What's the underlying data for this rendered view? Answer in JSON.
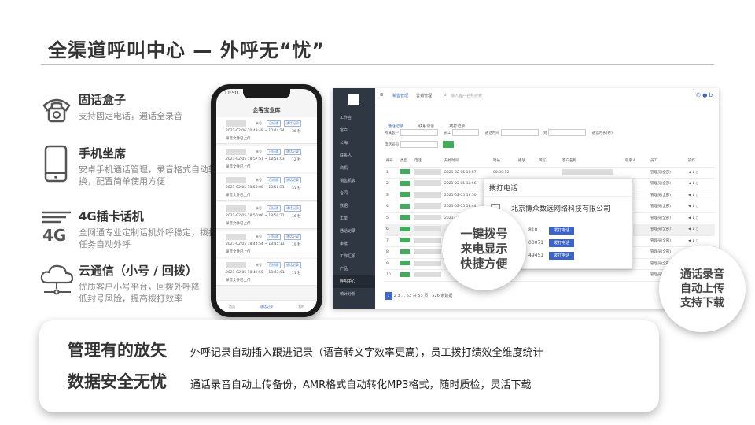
{
  "slide": {
    "title": "全渠道呼叫中心 — 外呼无“忧”"
  },
  "features": [
    {
      "icon": "telephone-icon",
      "title": "固话盒子",
      "desc": "支持固定电话，通话全录音"
    },
    {
      "icon": "smartphone-icon",
      "title": "手机坐席",
      "desc": "安卓手机通话管理，录音格式自动转换，配置简单使用方便"
    },
    {
      "icon": "4g-signal-icon",
      "title": "4G插卡话机",
      "desc": "全网通专业定制话机外呼稳定，拨打任务自动外呼"
    },
    {
      "icon": "cloud-network-icon",
      "title": "云通信（小号 / 回拨）",
      "desc": "优质客户小号平台，回拨外呼降低封号风险，提高拨打效率"
    }
  ],
  "phone": {
    "status_time": "11:50",
    "title": "企客宝业库",
    "items": [
      {
        "tag_a": "未号",
        "tag_b": "已接通",
        "tag_c": "通话记录",
        "time": "2021-02-06 10:43:48 ~ 10:44:24",
        "dur": "36 秒",
        "note": "录音文件已上传"
      },
      {
        "tag_a": "未号",
        "tag_b": "已接通",
        "tag_c": "通话记录",
        "time": "2021-02-05 18:57:51 ~ 18:58:03",
        "dur": "12 秒",
        "note": "录音文件已上传"
      },
      {
        "tag_a": "未号",
        "tag_b": "已接通",
        "tag_c": "通话记录",
        "time": "2021-02-05 18:50:00 ~ 18:50:31",
        "dur": "31 秒",
        "note": "录音文件已上传"
      },
      {
        "tag_a": "未号",
        "tag_b": "已接通",
        "tag_c": "通话记录",
        "time": "2021-02-05 18:50:06 ~ 18:50:22",
        "dur": "16 秒",
        "note": "录音文件已上传"
      },
      {
        "tag_a": "未号",
        "tag_b": "已接通",
        "tag_c": "通话记录",
        "time": "2021-02-05 18:44:54 ~ 18:45:13",
        "dur": "19 秒",
        "note": "录音文件已上传"
      },
      {
        "tag_a": "未号",
        "tag_b": "已接通",
        "tag_c": "通话记录",
        "time": "2021-02-05 18:42:50 ~ 18:43:01",
        "dur": "11 秒",
        "note": "录音文件已上传"
      }
    ],
    "nav": [
      "首页",
      "通话记录",
      "我的"
    ]
  },
  "desktop": {
    "top_tabs": [
      "销售管理",
      "营销管理"
    ],
    "search_placeholder": "输入客户名称搜索",
    "sidebar": [
      "工作台",
      "客户",
      "公海",
      "联系人",
      "商机",
      "销售机会",
      "合同",
      "数据",
      "工单",
      "通话记录",
      "审批",
      "工作汇报",
      "产品",
      "呼叫中心",
      "统计分析"
    ],
    "sub_tabs": [
      "通话记录",
      "联系记录",
      "拨打记录"
    ],
    "filters": {
      "customer_label": "所属客户",
      "customer_placeholder": "请输入客户名称",
      "employee_label": "员工",
      "employee_value": "请选择员工",
      "time_label": "通话时间",
      "to": "到",
      "duration_label": "通话时长(秒)",
      "tag_label": "电话号码"
    },
    "columns": [
      "编号",
      "类型",
      "电话",
      "开始时间",
      "时长",
      "播放",
      "转写",
      "客户名称",
      "联系人",
      "员工",
      "操作"
    ],
    "rows": [
      {
        "id": "1",
        "start": "2021-02-05 18:57",
        "dur": "00:00:12",
        "staff": "管理员(全部)"
      },
      {
        "id": "2",
        "start": "2021-02-05 18:56",
        "dur": "",
        "staff": "管理员(全部)"
      },
      {
        "id": "3",
        "start": "2021-02-05 18:50",
        "dur": "",
        "staff": "管理员(全部)"
      },
      {
        "id": "4",
        "start": "2021-02-05 18:44",
        "dur": "",
        "staff": "管理员(全部)"
      },
      {
        "id": "5",
        "start": "2021-02-05 18:42",
        "dur": "",
        "staff": "管理员(全部)"
      },
      {
        "id": "6",
        "start": "",
        "dur": "",
        "staff": "管理员(全部)"
      },
      {
        "id": "7",
        "start": "",
        "dur": "",
        "staff": "管理员(全部)"
      },
      {
        "id": "8",
        "start": "",
        "dur": "",
        "staff": "管理员(全部)"
      },
      {
        "id": "9",
        "start": "",
        "dur": "",
        "staff": "管理员(全部)"
      },
      {
        "id": "10",
        "start": "",
        "dur": "",
        "staff": "管理员(全部)"
      }
    ],
    "pager": {
      "current": "1",
      "pages": [
        "2",
        "3",
        "…",
        "53"
      ],
      "summary": "共 53 页，526 条数据"
    },
    "dial_popup": {
      "title": "拨打电话",
      "company": "北京博众数远网络科技有限公司",
      "nums": [
        "818",
        "00071",
        "49451"
      ],
      "call_label": "拨打电话"
    }
  },
  "bubbles": {
    "left": [
      "一键拨号",
      "来电显示",
      "快捷方便"
    ],
    "right": [
      "通话录音",
      "自动上传",
      "支持下载"
    ]
  },
  "card": {
    "line1_head": "管理有的放矢",
    "line1_text": "外呼记录自动插入跟进记录（语音转文字效率更高），员工拨打绩效全维度统计",
    "line2_head": "数据安全无忧",
    "line2_text": "通话录音自动上传备份，AMR格式自动转化MP3格式，随时质检，灵活下载"
  }
}
